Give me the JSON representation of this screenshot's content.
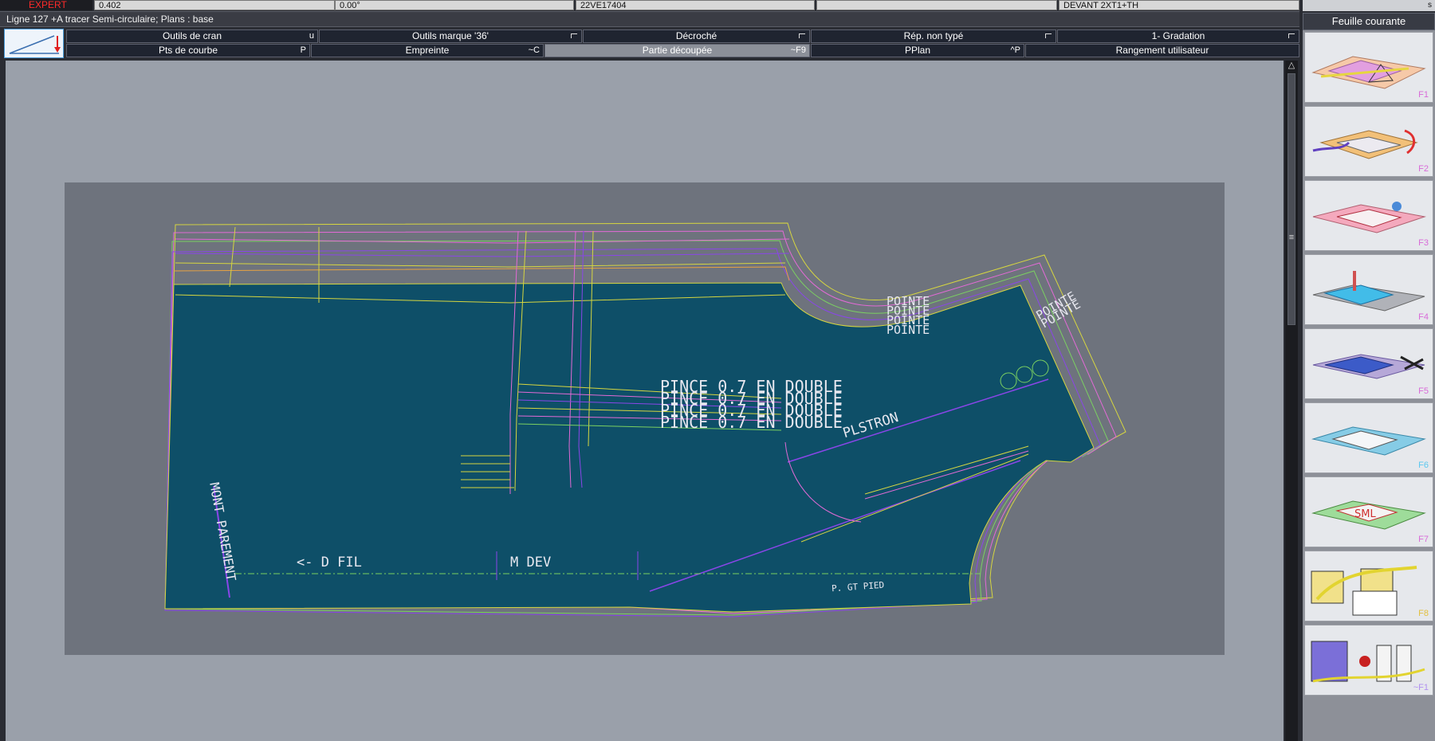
{
  "status": {
    "mode": "EXPERT",
    "fields": [
      "0.402",
      "0.00°",
      "22VE17404",
      "",
      "DEVANT 2XT1+TH"
    ],
    "info": "Ligne 127 +A tracer    Semi-circulaire;    Plans :  base"
  },
  "toolbar": {
    "row1": [
      {
        "label": "Outils de cran",
        "shortcut": "u"
      },
      {
        "label": "Outils marque '36'",
        "shortcut": ""
      },
      {
        "label": "Décroché",
        "shortcut": ""
      },
      {
        "label": "Rép. non typé",
        "shortcut": ""
      },
      {
        "label": "1- Gradation",
        "shortcut": ""
      }
    ],
    "row2": [
      {
        "label": "Pts de courbe",
        "shortcut": "P"
      },
      {
        "label": "Empreinte",
        "shortcut": "~C"
      },
      {
        "label": "Partie découpée",
        "shortcut": "~F9"
      },
      {
        "label": "PPlan",
        "shortcut": "^P"
      },
      {
        "label": "Rangement utilisateur",
        "shortcut": ""
      }
    ]
  },
  "pattern": {
    "texts": {
      "pince": "PINCE 0.7 EN DOUBLE",
      "plastron": "PLSTRON",
      "dfil": "<- D FIL",
      "mdev": "M DEV",
      "parement": "MONT PAREMENT",
      "poignee": "POINTE",
      "rondelle": "P. GT PIED"
    },
    "colors": {
      "piece_fill": "#0e4f68",
      "grade_yellow": "#d6d640",
      "grade_pink": "#e26ad6",
      "grade_purple": "#8a46e8",
      "grade_green": "#7bd061",
      "grade_orange": "#e7a243"
    }
  },
  "right_panel": {
    "title": "Feuille courante",
    "top_label": "s",
    "tiles": [
      {
        "key": "F1",
        "icon": "drafting-icon"
      },
      {
        "key": "F2",
        "icon": "rotate-piece-icon"
      },
      {
        "key": "F3",
        "icon": "digitize-icon"
      },
      {
        "key": "F4",
        "icon": "edit-piece-icon"
      },
      {
        "key": "F5",
        "icon": "cut-piece-icon"
      },
      {
        "key": "F6",
        "icon": "piece-outline-icon"
      },
      {
        "key": "F7",
        "icon": "size-grade-icon"
      },
      {
        "key": "F8",
        "icon": "measurement-chart-icon"
      },
      {
        "key": "~F1",
        "icon": "garment-models-icon"
      }
    ]
  }
}
